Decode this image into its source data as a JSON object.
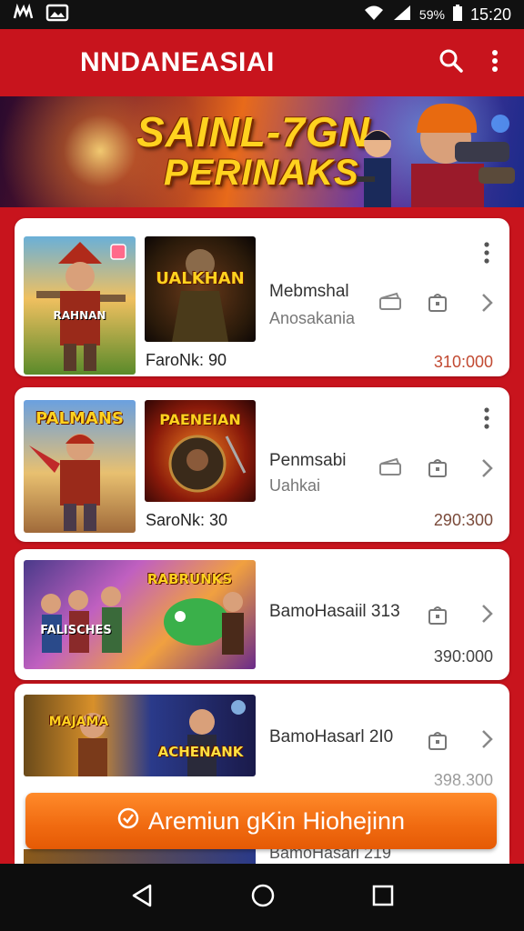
{
  "status_bar": {
    "time": "15:20",
    "battery": "59%"
  },
  "app_bar": {
    "title": "NNDANEASIAI"
  },
  "banner": {
    "line1": "SAINL-7GN",
    "line2": "PERINAKS"
  },
  "cards": [
    {
      "thumb1_label": "RAHNAN",
      "thumb2_label": "UALKHAN",
      "caption": "FaroNk:  90",
      "name": "Mebmshal",
      "sub": "Anosakania",
      "price": "310:000",
      "price_color": "#c24a32"
    },
    {
      "thumb1_label": "PALMANS",
      "thumb2_label": "PAENEIAN",
      "caption": "SaroNk:  30",
      "name": "Penmsabi",
      "sub": "Uahkai",
      "price": "290:300",
      "price_color": "#7a4a3a"
    },
    {
      "thumb_label": "RABRUNKS",
      "thumb_sub_label": "FALISCHES",
      "name": "BamoHasaiil 313",
      "price": "390:000",
      "price_color": "#444444"
    },
    {
      "thumb_label": "MAJAMA",
      "thumb_label_2": "ACHENANK",
      "name": "BamoHasarl 2I0",
      "price": "398.300",
      "price_color": "#444444"
    }
  ],
  "peek_card": {
    "name": "BamoHasarl 219"
  },
  "cta": {
    "label": "Aremiun gKin Hiohejinn"
  },
  "colors": {
    "app_red": "#c8141d",
    "cta_orange": "#f06a10",
    "banner_yellow": "#ffd21f"
  },
  "icons": [
    "search-icon",
    "kebab-menu-icon",
    "chevron-right-icon",
    "wallet-icon",
    "bag-icon",
    "back-icon",
    "home-icon",
    "recents-icon"
  ]
}
